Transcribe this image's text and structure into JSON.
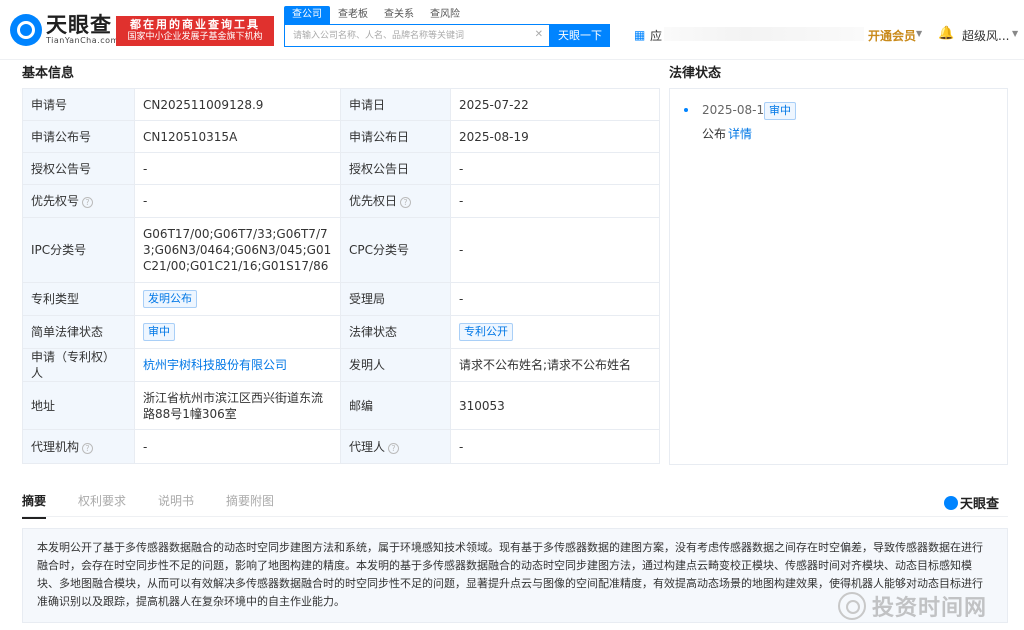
{
  "header": {
    "logo_title": "天眼查",
    "logo_domain": "TianYanCha.com",
    "slogan_line1": "都在用的商业查询工具",
    "slogan_line2": "国家中小企业发展子基金旗下机构",
    "tabs": [
      {
        "label": "查公司",
        "active": true
      },
      {
        "label": "查老板",
        "active": false
      },
      {
        "label": "查关系",
        "active": false
      },
      {
        "label": "查风险",
        "active": false
      }
    ],
    "search_placeholder": "请输入公司名称、人名、品牌名称等关键词",
    "search_button": "天眼一下",
    "app_text": "应",
    "vip_label": "开通会员",
    "user_name": "超级风..."
  },
  "basic_info": {
    "title": "基本信息",
    "rows": [
      {
        "l1": "申请号",
        "v1": "CN202511009128.9",
        "l2": "申请日",
        "v2": "2025-07-22"
      },
      {
        "l1": "申请公布号",
        "v1": "CN120510315A",
        "l2": "申请公布日",
        "v2": "2025-08-19"
      },
      {
        "l1": "授权公告号",
        "v1": "-",
        "l2": "授权公告日",
        "v2": "-"
      },
      {
        "l1": "优先权号",
        "v1": "-",
        "l2": "优先权日",
        "v2": "-"
      },
      {
        "l1": "IPC分类号",
        "v1": "G06T17/00;G06T7/33;G06T7/73;G06N3/0464;G06N3/045;G01C21/00;G01C21/16;G01S17/86",
        "l2": "CPC分类号",
        "v2": "-"
      },
      {
        "l1": "专利类型",
        "v1": "发明公布",
        "l2": "受理局",
        "v2": "-"
      },
      {
        "l1": "简单法律状态",
        "v1": "审中",
        "l2": "法律状态",
        "v2": "专利公开"
      },
      {
        "l1": "申请（专利权）人",
        "v1": "杭州宇树科技股份有限公司",
        "l2": "发明人",
        "v2": "请求不公布姓名;请求不公布姓名"
      },
      {
        "l1": "地址",
        "v1": "浙江省杭州市滨江区西兴街道东流路88号1幢306室",
        "l2": "邮编",
        "v2": "310053"
      },
      {
        "l1": "代理机构",
        "v1": "-",
        "l2": "代理人",
        "v2": "-"
      }
    ]
  },
  "legal_status": {
    "title": "法律状态",
    "date": "2025-08-19",
    "tag": "审中",
    "desc": "公布",
    "link": "详情"
  },
  "subtabs": [
    {
      "label": "摘要",
      "active": true
    },
    {
      "label": "权利要求",
      "active": false
    },
    {
      "label": "说明书",
      "active": false
    },
    {
      "label": "摘要附图",
      "active": false
    }
  ],
  "brand_small": "天眼查",
  "abstract": "本发明公开了基于多传感器数据融合的动态时空同步建图方法和系统，属于环境感知技术领域。现有基于多传感器数据的建图方案，没有考虑传感器数据之间存在时空偏差，导致传感器数据在进行融合时，会存在时空同步性不足的问题，影响了地图构建的精度。本发明的基于多传感器数据融合的动态时空同步建图方法，通过构建点云畸变校正模块、传感器时间对齐模块、动态目标感知模块、多地图融合模块，从而可以有效解决多传感器数据融合时的时空同步性不足的问题，显著提升点云与图像的空间配准精度，有效提高动态场景的地图构建效果，使得机器人能够对动态目标进行准确识别以及跟踪，提高机器人在复杂环境中的自主作业能力。",
  "watermark": "投资时间网"
}
